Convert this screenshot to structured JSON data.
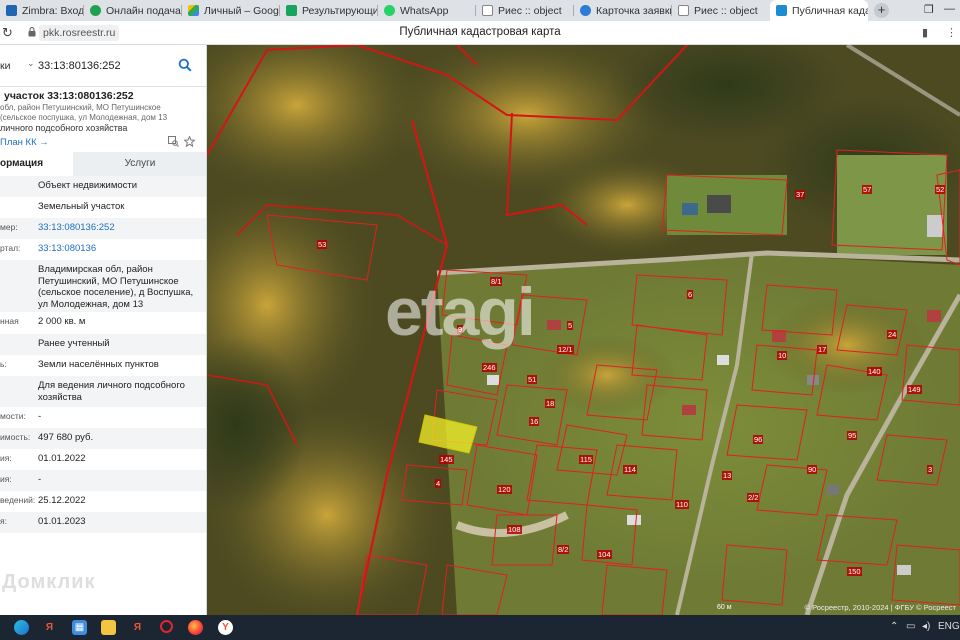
{
  "browser": {
    "tabs": [
      {
        "label": "Zimbra: Входящие",
        "color": "#1f65b0"
      },
      {
        "label": "Онлайн подача заг",
        "color": "#20a050"
      },
      {
        "label": "Личный – Google Д",
        "color": "#3b78e7"
      },
      {
        "label": "Результирующие П",
        "color": "#19a35c"
      },
      {
        "label": "WhatsApp",
        "color": "#25d366"
      },
      {
        "label": "Риес :: object",
        "color": "#e0e0e0"
      },
      {
        "label": "Карточка заявки",
        "color": "#2e7bd6"
      },
      {
        "label": "Риес :: object",
        "color": "#e0e0e0"
      },
      {
        "label": "Публичная кадаст",
        "color": "#1a8ccf"
      }
    ],
    "active_tab_index": 8,
    "url": "pkk.rosreestr.ru",
    "page_title": "Публичная кадастровая карта"
  },
  "panel": {
    "search_category": "ки",
    "search_value": "33:13:80136:252",
    "object_title": "участок 33:13:080136:252",
    "object_address": "обл, район Петушинский, МО Петушинское (сельское поспушка, ул Молодежная, дом 13",
    "object_use": "личного подсобного хозяйства",
    "plan_link": "План КК →",
    "tab_info": "ормация",
    "tab_services": "Услуги",
    "properties": [
      {
        "key": "",
        "value": "Объект недвижимости",
        "link": false
      },
      {
        "key": "",
        "value": "Земельный участок",
        "link": false
      },
      {
        "key": "мер:",
        "value": "33:13:080136:252",
        "link": true
      },
      {
        "key": "ртал:",
        "value": "33:13:080136",
        "link": true
      },
      {
        "key": "",
        "value": "Владимирская обл, район Петушинский, МО Петушинское (сельское поселение), д Воспушка, ул Молодежная, дом 13",
        "link": false
      },
      {
        "key": "нная",
        "value": "2 000 кв. м",
        "link": false
      },
      {
        "key": "",
        "value": "Ранее учтенный",
        "link": false
      },
      {
        "key": "ь:",
        "value": "Земли населённых пунктов",
        "link": false
      },
      {
        "key": "",
        "value": "Для ведения личного подсобного хозяйства",
        "link": false
      },
      {
        "key": "мости:",
        "value": "-",
        "link": false
      },
      {
        "key": "имость:",
        "value": "497 680 руб.",
        "link": false
      },
      {
        "key": "ия:",
        "value": "01.01.2022",
        "link": false
      },
      {
        "key": "ия:",
        "value": "-",
        "link": false
      },
      {
        "key": "ведений:",
        "value": "25.12.2022",
        "link": false
      },
      {
        "key": "я:",
        "value": "01.01.2023",
        "link": false
      }
    ],
    "domclick_watermark": "Домклик"
  },
  "map": {
    "watermark": "etagi",
    "copyright": "© Росреестр, 2010-2024 | ФГБУ © Росреест",
    "scale_label": "60 м",
    "plot_labels": [
      "53",
      "57",
      "52",
      "8/1",
      "6",
      "5",
      "12/1",
      "37",
      "246",
      "18",
      "16",
      "145",
      "120",
      "115",
      "108",
      "8/2",
      "114",
      "96",
      "13",
      "95",
      "90",
      "17",
      "10",
      "3",
      "24",
      "2/2",
      "140",
      "149",
      "104",
      "110",
      "9",
      "51",
      "150",
      "4"
    ]
  },
  "taskbar": {
    "lang": "ENG",
    "icons": [
      "edge",
      "yandex",
      "store",
      "explorer",
      "yandex-browser",
      "opera",
      "firefox",
      "yandex-alt"
    ]
  }
}
